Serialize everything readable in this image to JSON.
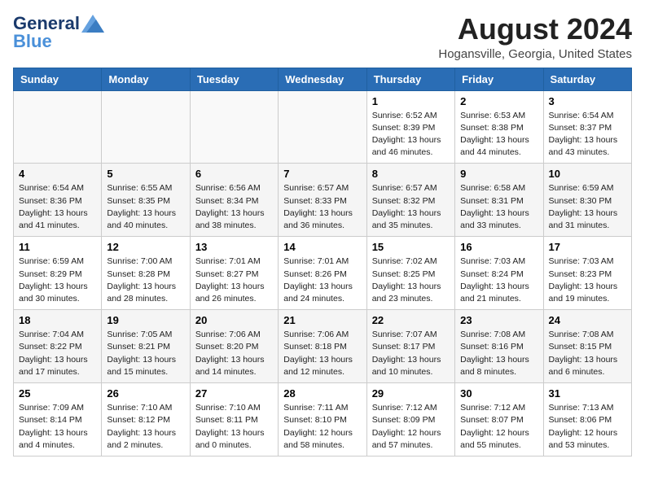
{
  "header": {
    "logo_general": "General",
    "logo_blue": "Blue",
    "title": "August 2024",
    "location": "Hogansville, Georgia, United States"
  },
  "weekdays": [
    "Sunday",
    "Monday",
    "Tuesday",
    "Wednesday",
    "Thursday",
    "Friday",
    "Saturday"
  ],
  "weeks": [
    [
      {
        "day": "",
        "info": ""
      },
      {
        "day": "",
        "info": ""
      },
      {
        "day": "",
        "info": ""
      },
      {
        "day": "",
        "info": ""
      },
      {
        "day": "1",
        "info": "Sunrise: 6:52 AM\nSunset: 8:39 PM\nDaylight: 13 hours\nand 46 minutes."
      },
      {
        "day": "2",
        "info": "Sunrise: 6:53 AM\nSunset: 8:38 PM\nDaylight: 13 hours\nand 44 minutes."
      },
      {
        "day": "3",
        "info": "Sunrise: 6:54 AM\nSunset: 8:37 PM\nDaylight: 13 hours\nand 43 minutes."
      }
    ],
    [
      {
        "day": "4",
        "info": "Sunrise: 6:54 AM\nSunset: 8:36 PM\nDaylight: 13 hours\nand 41 minutes."
      },
      {
        "day": "5",
        "info": "Sunrise: 6:55 AM\nSunset: 8:35 PM\nDaylight: 13 hours\nand 40 minutes."
      },
      {
        "day": "6",
        "info": "Sunrise: 6:56 AM\nSunset: 8:34 PM\nDaylight: 13 hours\nand 38 minutes."
      },
      {
        "day": "7",
        "info": "Sunrise: 6:57 AM\nSunset: 8:33 PM\nDaylight: 13 hours\nand 36 minutes."
      },
      {
        "day": "8",
        "info": "Sunrise: 6:57 AM\nSunset: 8:32 PM\nDaylight: 13 hours\nand 35 minutes."
      },
      {
        "day": "9",
        "info": "Sunrise: 6:58 AM\nSunset: 8:31 PM\nDaylight: 13 hours\nand 33 minutes."
      },
      {
        "day": "10",
        "info": "Sunrise: 6:59 AM\nSunset: 8:30 PM\nDaylight: 13 hours\nand 31 minutes."
      }
    ],
    [
      {
        "day": "11",
        "info": "Sunrise: 6:59 AM\nSunset: 8:29 PM\nDaylight: 13 hours\nand 30 minutes."
      },
      {
        "day": "12",
        "info": "Sunrise: 7:00 AM\nSunset: 8:28 PM\nDaylight: 13 hours\nand 28 minutes."
      },
      {
        "day": "13",
        "info": "Sunrise: 7:01 AM\nSunset: 8:27 PM\nDaylight: 13 hours\nand 26 minutes."
      },
      {
        "day": "14",
        "info": "Sunrise: 7:01 AM\nSunset: 8:26 PM\nDaylight: 13 hours\nand 24 minutes."
      },
      {
        "day": "15",
        "info": "Sunrise: 7:02 AM\nSunset: 8:25 PM\nDaylight: 13 hours\nand 23 minutes."
      },
      {
        "day": "16",
        "info": "Sunrise: 7:03 AM\nSunset: 8:24 PM\nDaylight: 13 hours\nand 21 minutes."
      },
      {
        "day": "17",
        "info": "Sunrise: 7:03 AM\nSunset: 8:23 PM\nDaylight: 13 hours\nand 19 minutes."
      }
    ],
    [
      {
        "day": "18",
        "info": "Sunrise: 7:04 AM\nSunset: 8:22 PM\nDaylight: 13 hours\nand 17 minutes."
      },
      {
        "day": "19",
        "info": "Sunrise: 7:05 AM\nSunset: 8:21 PM\nDaylight: 13 hours\nand 15 minutes."
      },
      {
        "day": "20",
        "info": "Sunrise: 7:06 AM\nSunset: 8:20 PM\nDaylight: 13 hours\nand 14 minutes."
      },
      {
        "day": "21",
        "info": "Sunrise: 7:06 AM\nSunset: 8:18 PM\nDaylight: 13 hours\nand 12 minutes."
      },
      {
        "day": "22",
        "info": "Sunrise: 7:07 AM\nSunset: 8:17 PM\nDaylight: 13 hours\nand 10 minutes."
      },
      {
        "day": "23",
        "info": "Sunrise: 7:08 AM\nSunset: 8:16 PM\nDaylight: 13 hours\nand 8 minutes."
      },
      {
        "day": "24",
        "info": "Sunrise: 7:08 AM\nSunset: 8:15 PM\nDaylight: 13 hours\nand 6 minutes."
      }
    ],
    [
      {
        "day": "25",
        "info": "Sunrise: 7:09 AM\nSunset: 8:14 PM\nDaylight: 13 hours\nand 4 minutes."
      },
      {
        "day": "26",
        "info": "Sunrise: 7:10 AM\nSunset: 8:12 PM\nDaylight: 13 hours\nand 2 minutes."
      },
      {
        "day": "27",
        "info": "Sunrise: 7:10 AM\nSunset: 8:11 PM\nDaylight: 13 hours\nand 0 minutes."
      },
      {
        "day": "28",
        "info": "Sunrise: 7:11 AM\nSunset: 8:10 PM\nDaylight: 12 hours\nand 58 minutes."
      },
      {
        "day": "29",
        "info": "Sunrise: 7:12 AM\nSunset: 8:09 PM\nDaylight: 12 hours\nand 57 minutes."
      },
      {
        "day": "30",
        "info": "Sunrise: 7:12 AM\nSunset: 8:07 PM\nDaylight: 12 hours\nand 55 minutes."
      },
      {
        "day": "31",
        "info": "Sunrise: 7:13 AM\nSunset: 8:06 PM\nDaylight: 12 hours\nand 53 minutes."
      }
    ]
  ]
}
